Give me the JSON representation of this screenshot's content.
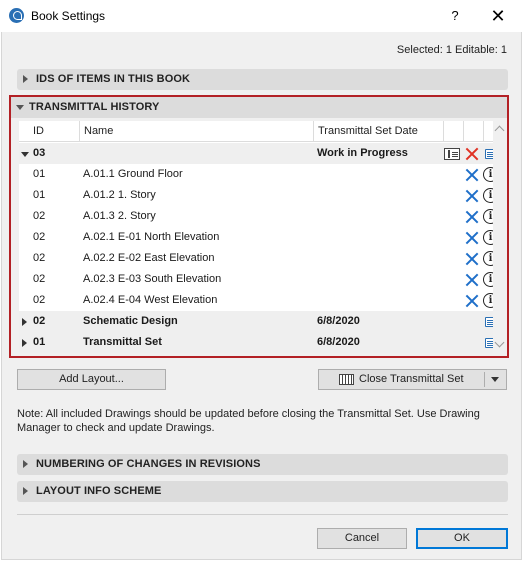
{
  "window": {
    "title": "Book Settings",
    "help_label": "?",
    "close_label": "✕"
  },
  "selected_info": "Selected: 1 Editable: 1",
  "sections": {
    "ids_of_items": "IDS OF ITEMS IN THIS BOOK",
    "transmittal_history": "TRANSMITTAL HISTORY",
    "numbering": "NUMBERING OF CHANGES IN REVISIONS",
    "layout_info": "LAYOUT INFO SCHEME"
  },
  "table": {
    "columns": {
      "id": "ID",
      "name": "Name",
      "date": "Transmittal Set Date"
    },
    "rows": [
      {
        "kind": "group",
        "expanded": true,
        "id": "03",
        "name": "",
        "date": "Work in Progress"
      },
      {
        "kind": "item",
        "id": "01",
        "name": "A.01.1 Ground Floor",
        "date": ""
      },
      {
        "kind": "item",
        "id": "01",
        "name": "A.01.2 1. Story",
        "date": ""
      },
      {
        "kind": "item",
        "id": "02",
        "name": "A.01.3 2. Story",
        "date": ""
      },
      {
        "kind": "item",
        "id": "02",
        "name": "A.02.1 E-01 North Elevation",
        "date": ""
      },
      {
        "kind": "item",
        "id": "02",
        "name": "A.02.2 E-02 East Elevation",
        "date": ""
      },
      {
        "kind": "item",
        "id": "02",
        "name": "A.02.3 E-03 South Elevation",
        "date": ""
      },
      {
        "kind": "item",
        "id": "02",
        "name": "A.02.4 E-04 West Elevation",
        "date": ""
      },
      {
        "kind": "group",
        "expanded": false,
        "id": "02",
        "name": "Schematic Design",
        "date": "6/8/2020"
      },
      {
        "kind": "group",
        "expanded": false,
        "id": "01",
        "name": "Transmittal Set",
        "date": "6/8/2020"
      }
    ]
  },
  "buttons": {
    "add_layout": "Add Layout...",
    "close_transmittal_set": "Close Transmittal Set",
    "cancel": "Cancel",
    "ok": "OK"
  },
  "note": "Note: All included Drawings should be updated before closing the Transmittal Set. Use Drawing Manager to check and update Drawings.",
  "icons": {
    "remove": "x-icon",
    "info": "info-icon",
    "details": "document-icon",
    "close_set": "book-icon"
  },
  "colors": {
    "highlight_border": "#b32025",
    "blue_x": "#1f6fc9",
    "red_x": "#e03224",
    "accent": "#0078d7"
  }
}
